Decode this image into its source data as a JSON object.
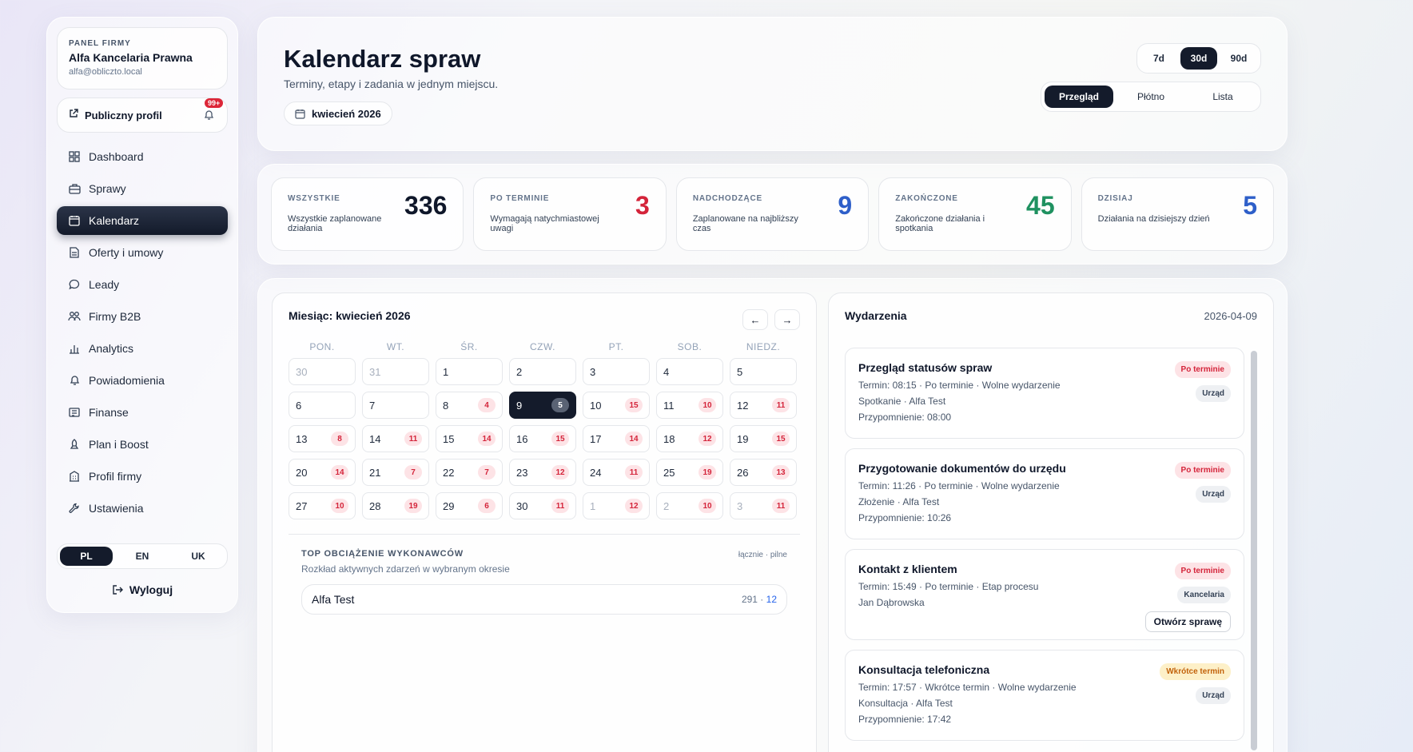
{
  "sidebar": {
    "eyebrow": "PANEL FIRMY",
    "company": "Alfa Kancelaria Prawna",
    "email": "alfa@obliczto.local",
    "public_profile": "Publiczny profil",
    "notif_badge": "99+",
    "items": [
      {
        "label": "Dashboard",
        "icon": "grid-icon"
      },
      {
        "label": "Sprawy",
        "icon": "briefcase-icon"
      },
      {
        "label": "Kalendarz",
        "icon": "calendar-icon"
      },
      {
        "label": "Oferty i umowy",
        "icon": "document-icon"
      },
      {
        "label": "Leady",
        "icon": "chat-icon"
      },
      {
        "label": "Firmy B2B",
        "icon": "users-icon"
      },
      {
        "label": "Analytics",
        "icon": "bar-chart-icon"
      },
      {
        "label": "Powiadomienia",
        "icon": "bell-icon"
      },
      {
        "label": "Finanse",
        "icon": "receipt-icon"
      },
      {
        "label": "Plan i Boost",
        "icon": "rocket-icon"
      },
      {
        "label": "Profil firmy",
        "icon": "building-icon"
      },
      {
        "label": "Ustawienia",
        "icon": "wrench-icon"
      }
    ],
    "active_index": 2,
    "langs": [
      "PL",
      "EN",
      "UK"
    ],
    "logout": "Wyloguj"
  },
  "header": {
    "title": "Kalendarz spraw",
    "subtitle": "Terminy, etapy i zadania w jednym miejscu.",
    "month": "kwiecień 2026",
    "ranges": [
      "7d",
      "30d",
      "90d"
    ],
    "views": [
      "Przegląd",
      "Płótno",
      "Lista"
    ]
  },
  "stats": [
    {
      "title": "WSZYSTKIE",
      "desc": "Wszystkie zaplanowane działania",
      "value": "336",
      "color": "#0f172a"
    },
    {
      "title": "PO TERMINIE",
      "desc": "Wymagają natychmiastowej uwagi",
      "value": "3",
      "color": "#d4243a"
    },
    {
      "title": "NADCHODZĄCE",
      "desc": "Zaplanowane na najbliższy czas",
      "value": "9",
      "color": "#2e5fc9"
    },
    {
      "title": "ZAKOŃCZONE",
      "desc": "Zakończone działania i spotkania",
      "value": "45",
      "color": "#1f9160"
    },
    {
      "title": "DZISIAJ",
      "desc": "Działania na dzisiejszy dzień",
      "value": "5",
      "color": "#2e5fc9"
    }
  ],
  "calendar": {
    "title": "Miesiąc: kwiecień 2026",
    "prev": "←",
    "next": "→",
    "weekdays": [
      "PON.",
      "WT.",
      "ŚR.",
      "CZW.",
      "PT.",
      "SOB.",
      "NIEDZ."
    ],
    "days": [
      {
        "d": "30",
        "c": "",
        "m": true
      },
      {
        "d": "31",
        "c": "",
        "m": true
      },
      {
        "d": "1",
        "c": ""
      },
      {
        "d": "2",
        "c": ""
      },
      {
        "d": "3",
        "c": ""
      },
      {
        "d": "4",
        "c": ""
      },
      {
        "d": "5",
        "c": ""
      },
      {
        "d": "6",
        "c": ""
      },
      {
        "d": "7",
        "c": ""
      },
      {
        "d": "8",
        "c": "4"
      },
      {
        "d": "9",
        "c": "5",
        "s": true
      },
      {
        "d": "10",
        "c": "15"
      },
      {
        "d": "11",
        "c": "10"
      },
      {
        "d": "12",
        "c": "11"
      },
      {
        "d": "13",
        "c": "8"
      },
      {
        "d": "14",
        "c": "11"
      },
      {
        "d": "15",
        "c": "14"
      },
      {
        "d": "16",
        "c": "15"
      },
      {
        "d": "17",
        "c": "14"
      },
      {
        "d": "18",
        "c": "12"
      },
      {
        "d": "19",
        "c": "15"
      },
      {
        "d": "20",
        "c": "14"
      },
      {
        "d": "21",
        "c": "7"
      },
      {
        "d": "22",
        "c": "7"
      },
      {
        "d": "23",
        "c": "12"
      },
      {
        "d": "24",
        "c": "11"
      },
      {
        "d": "25",
        "c": "19"
      },
      {
        "d": "26",
        "c": "13"
      },
      {
        "d": "27",
        "c": "10"
      },
      {
        "d": "28",
        "c": "19"
      },
      {
        "d": "29",
        "c": "6"
      },
      {
        "d": "30",
        "c": "11"
      },
      {
        "d": "1",
        "c": "12",
        "m": true
      },
      {
        "d": "2",
        "c": "10",
        "m": true
      },
      {
        "d": "3",
        "c": "11",
        "m": true
      }
    ],
    "load_title": "TOP OBCIĄŻENIE WYKONAWCÓW",
    "load_hint": "łącznie · pilne",
    "load_sub": "Rozkład aktywnych zdarzeń w wybranym okresie",
    "load_rows": [
      {
        "name": "Alfa Test",
        "total": "291",
        "urgent": "12"
      }
    ]
  },
  "events": {
    "title": "Wydarzenia",
    "date": "2026-04-09",
    "open_label": "Otwórz sprawę",
    "items": [
      {
        "title": "Przegląd statusów spraw",
        "lines": [
          "Termin: 08:15 · Po terminie · Wolne wydarzenie",
          "Spotkanie · Alfa Test",
          "Przypomnienie: 08:00"
        ],
        "status": "Po terminie",
        "warn": false,
        "tag": "Urząd",
        "open": false
      },
      {
        "title": "Przygotowanie dokumentów do urzędu",
        "lines": [
          "Termin: 11:26 · Po terminie · Wolne wydarzenie",
          "Złożenie · Alfa Test",
          "Przypomnienie: 10:26"
        ],
        "status": "Po terminie",
        "warn": false,
        "tag": "Urząd",
        "open": false
      },
      {
        "title": "Kontakt z klientem",
        "lines": [
          "Termin: 15:49 · Po terminie · Etap procesu",
          "Jan Dąbrowska"
        ],
        "status": "Po terminie",
        "warn": false,
        "tag": "Kancelaria",
        "open": true
      },
      {
        "title": "Konsultacja telefoniczna",
        "lines": [
          "Termin: 17:57 · Wkrótce termin · Wolne wydarzenie",
          "Konsultacja · Alfa Test",
          "Przypomnienie: 17:42"
        ],
        "status": "Wkrótce termin",
        "warn": true,
        "tag": "Urząd",
        "open": false
      }
    ]
  }
}
